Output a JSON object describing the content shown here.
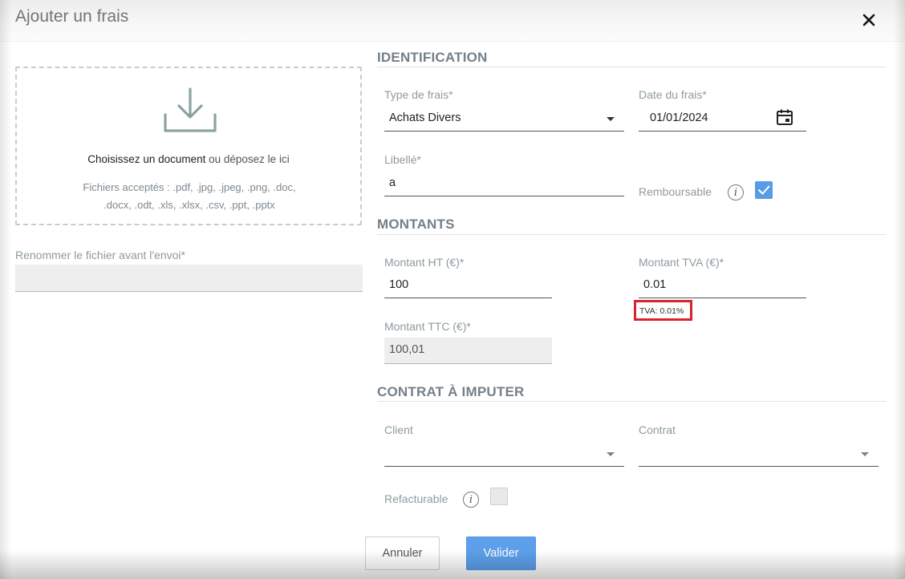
{
  "dialog": {
    "title": "Ajouter un frais",
    "close_icon": "close-icon"
  },
  "upload": {
    "icon": "download-icon",
    "choose_strong": "Choisissez un document",
    "choose_rest": " ou déposez le ici",
    "accepted_line1": "Fichiers acceptés : .pdf, .jpg, .jpeg, .png, .doc,",
    "accepted_line2": ".docx, .odt, .xls, .xlsx, .csv, .ppt, .pptx",
    "rename_label": "Renommer le fichier avant l'envoi*",
    "rename_value": ""
  },
  "identification": {
    "title": "IDENTIFICATION",
    "type_label": "Type de frais*",
    "type_value": "Achats Divers",
    "date_label": "Date du frais*",
    "date_value": "01/01/2024",
    "date_icon": "calendar-icon",
    "libelle_label": "Libellé*",
    "libelle_value": "a",
    "remboursable_label": "Remboursable",
    "remboursable_info_glyph": "i",
    "remboursable_checked": true
  },
  "montants": {
    "title": "MONTANTS",
    "ht_label": "Montant HT (€)*",
    "ht_value": "100",
    "tva_label": "Montant TVA (€)*",
    "tva_value": "0.01",
    "tva_hint": "TVA: 0.01%",
    "ttc_label": "Montant TTC (€)*",
    "ttc_value": "100,01"
  },
  "contrat": {
    "title": "CONTRAT À IMPUTER",
    "client_label": "Client",
    "client_value": "",
    "contrat_label": "Contrat",
    "contrat_value": "",
    "refacturable_label": "Refacturable",
    "refacturable_info_glyph": "i",
    "refacturable_checked": false
  },
  "actions": {
    "cancel_label": "Annuler",
    "submit_label": "Valider"
  },
  "colors": {
    "primary": "#5d9fea",
    "highlight_border": "#d9232f",
    "section_title": "#74808a"
  }
}
